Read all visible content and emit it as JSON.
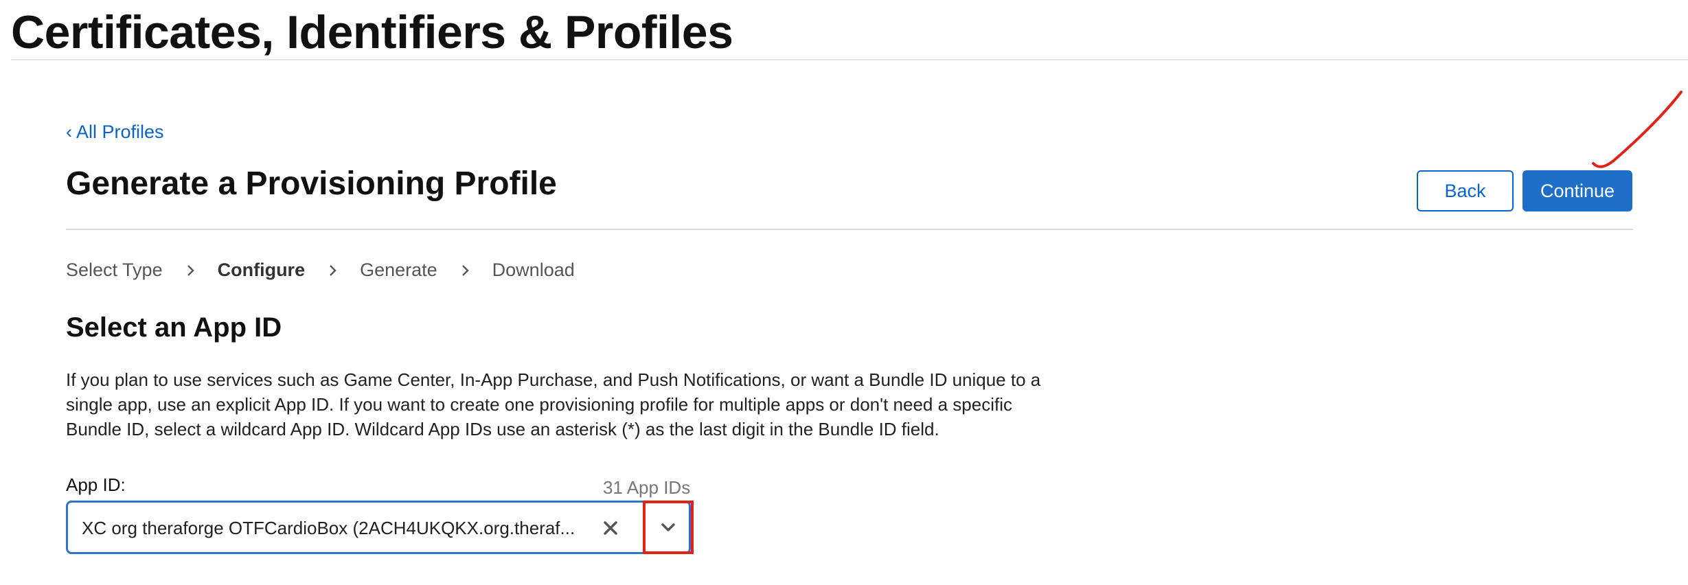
{
  "header": {
    "site_title": "Certificates, Identifiers & Profiles"
  },
  "nav": {
    "back_link": "‹ All Profiles"
  },
  "page": {
    "title": "Generate a Provisioning Profile",
    "actions": {
      "back_label": "Back",
      "continue_label": "Continue"
    }
  },
  "steps": [
    {
      "label": "Select Type",
      "active": false
    },
    {
      "label": "Configure",
      "active": true
    },
    {
      "label": "Generate",
      "active": false
    },
    {
      "label": "Download",
      "active": false
    }
  ],
  "section": {
    "title": "Select an App ID",
    "description": "If you plan to use services such as Game Center, In-App Purchase, and Push Notifications, or want a Bundle ID unique to a single app, use an explicit App ID. If you want to create one provisioning profile for multiple apps or don't need a specific Bundle ID, select a wildcard App ID. Wildcard App IDs use an asterisk (*) as the last digit in the Bundle ID field."
  },
  "app_id_field": {
    "label": "App ID:",
    "count": "31 App IDs",
    "selected_value": "XC org theraforge OTFCardioBox (2ACH4UKQKX.org.theraf..."
  },
  "icons": {
    "step_separator": "chevron-right-icon",
    "clear": "x-icon",
    "dropdown": "chevron-down-icon"
  },
  "colors": {
    "link": "#0b63c7",
    "primary_button": "#1f6fc9",
    "field_focus_border": "#2a74d0",
    "annotation": "#e2231a"
  }
}
